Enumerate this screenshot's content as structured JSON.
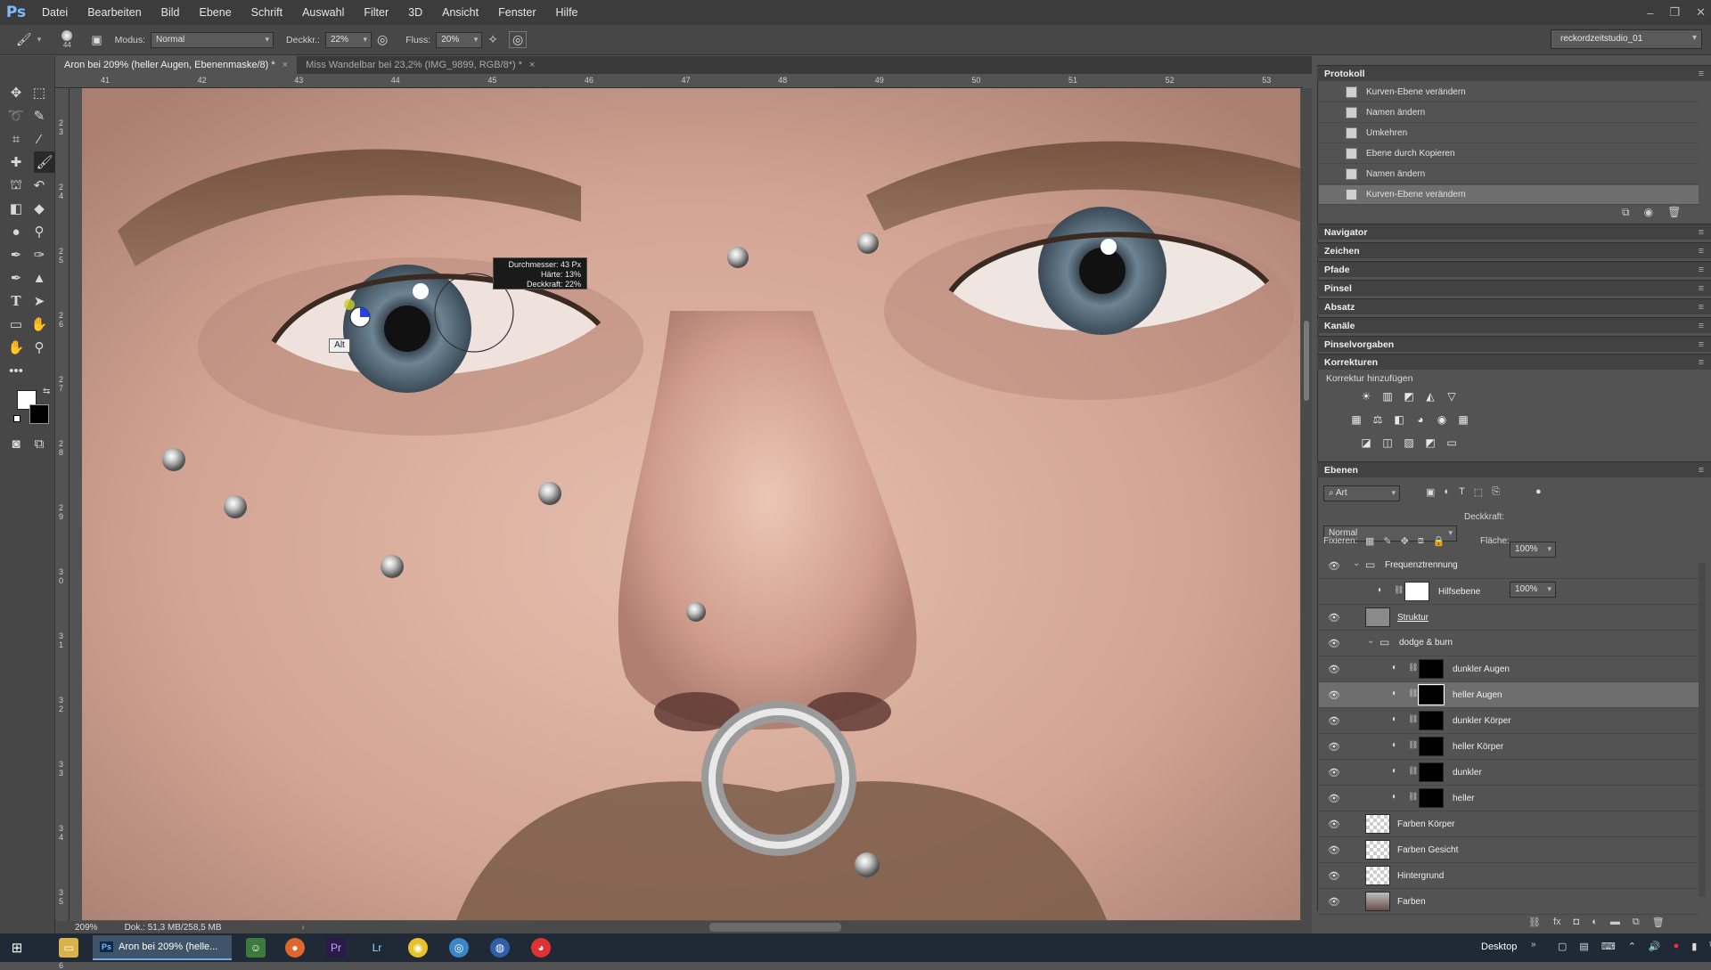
{
  "app": {
    "logo": "Ps"
  },
  "menu": [
    "Datei",
    "Bearbeiten",
    "Bild",
    "Ebene",
    "Schrift",
    "Auswahl",
    "Filter",
    "3D",
    "Ansicht",
    "Fenster",
    "Hilfe"
  ],
  "options": {
    "brush_size": "44",
    "mode_label": "Modus:",
    "mode_value": "Normal",
    "opacity_label": "Deckkr.:",
    "opacity_value": "22%",
    "flow_label": "Fluss:",
    "flow_value": "20%",
    "workspace": "reckordzeitstudio_01"
  },
  "tabs": [
    {
      "label": "Aron bei 209% (heller Augen, Ebenenmaske/8) *",
      "active": true
    },
    {
      "label": "Miss Wandelbar bei 23,2% (IMG_9899, RGB/8*) *",
      "active": false
    }
  ],
  "ruler_h": [
    "41",
    "42",
    "43",
    "44",
    "45",
    "46",
    "47",
    "48",
    "49",
    "50",
    "51",
    "52",
    "53"
  ],
  "ruler_v": [
    "2",
    "3",
    "2",
    "4",
    "2",
    "5",
    "2",
    "6",
    "2",
    "7",
    "2",
    "8",
    "2",
    "9",
    "3",
    "0",
    "3",
    "1",
    "3",
    "2",
    "3",
    "3",
    "3",
    "4",
    "3",
    "5",
    "3",
    "6"
  ],
  "brush_tooltip": {
    "line1": "Durchmesser: 43 Px",
    "line2": "Härte: 13%",
    "line3": "Deckkraft: 22%"
  },
  "alt_tooltip": "Alt",
  "status": {
    "zoom": "209%",
    "doc": "Dok.: 51,3 MB/258,5 MB"
  },
  "panels": {
    "protokoll": {
      "title": "Protokoll",
      "items": [
        "Kurven-Ebene verändern",
        "Namen ändern",
        "Umkehren",
        "Ebene durch Kopieren",
        "Namen ändern",
        "Kurven-Ebene verändern"
      ]
    },
    "collapsed": [
      "Navigator",
      "Zeichen",
      "Pfade",
      "Pinsel",
      "Absatz",
      "Kanäle",
      "Pinselvorgaben"
    ],
    "korrekturen": {
      "title": "Korrekturen",
      "subtitle": "Korrektur hinzufügen"
    },
    "ebenen": {
      "title": "Ebenen",
      "filter": "Art",
      "blend_mode": "Normal",
      "opacity_label": "Deckkraft:",
      "opacity": "100%",
      "lock_label": "Fixieren:",
      "fill_label": "Fläche:",
      "fill": "100%",
      "layers": [
        {
          "name": "Frequenztrennung",
          "type": "group"
        },
        {
          "name": "Hilfsebene",
          "type": "adj",
          "thumb": "white"
        },
        {
          "name": "Struktur",
          "type": "pixel",
          "thumb": "gray"
        },
        {
          "name": "dodge & burn",
          "type": "group"
        },
        {
          "name": "dunkler Augen",
          "type": "adj",
          "thumb": "black"
        },
        {
          "name": "heller Augen",
          "type": "adj",
          "thumb": "black",
          "selected": true
        },
        {
          "name": "dunkler Körper",
          "type": "adj",
          "thumb": "black"
        },
        {
          "name": "heller Körper",
          "type": "adj",
          "thumb": "black"
        },
        {
          "name": "dunkler",
          "type": "adj",
          "thumb": "black"
        },
        {
          "name": "heller",
          "type": "adj",
          "thumb": "black"
        },
        {
          "name": "Farben Körper",
          "type": "pixel",
          "thumb": "checker"
        },
        {
          "name": "Farben Gesicht",
          "type": "pixel",
          "thumb": "checker"
        },
        {
          "name": "Hintergrund",
          "type": "pixel",
          "thumb": "checker"
        },
        {
          "name": "Farben",
          "type": "pixel",
          "thumb": "photo"
        }
      ]
    }
  },
  "taskbar": {
    "active_app": "Aron bei 209% (helle...",
    "desktop": "Desktop"
  },
  "colors": {
    "accent": "#79a9d9",
    "menubar": "#3c3c3c",
    "panel": "#535353"
  }
}
